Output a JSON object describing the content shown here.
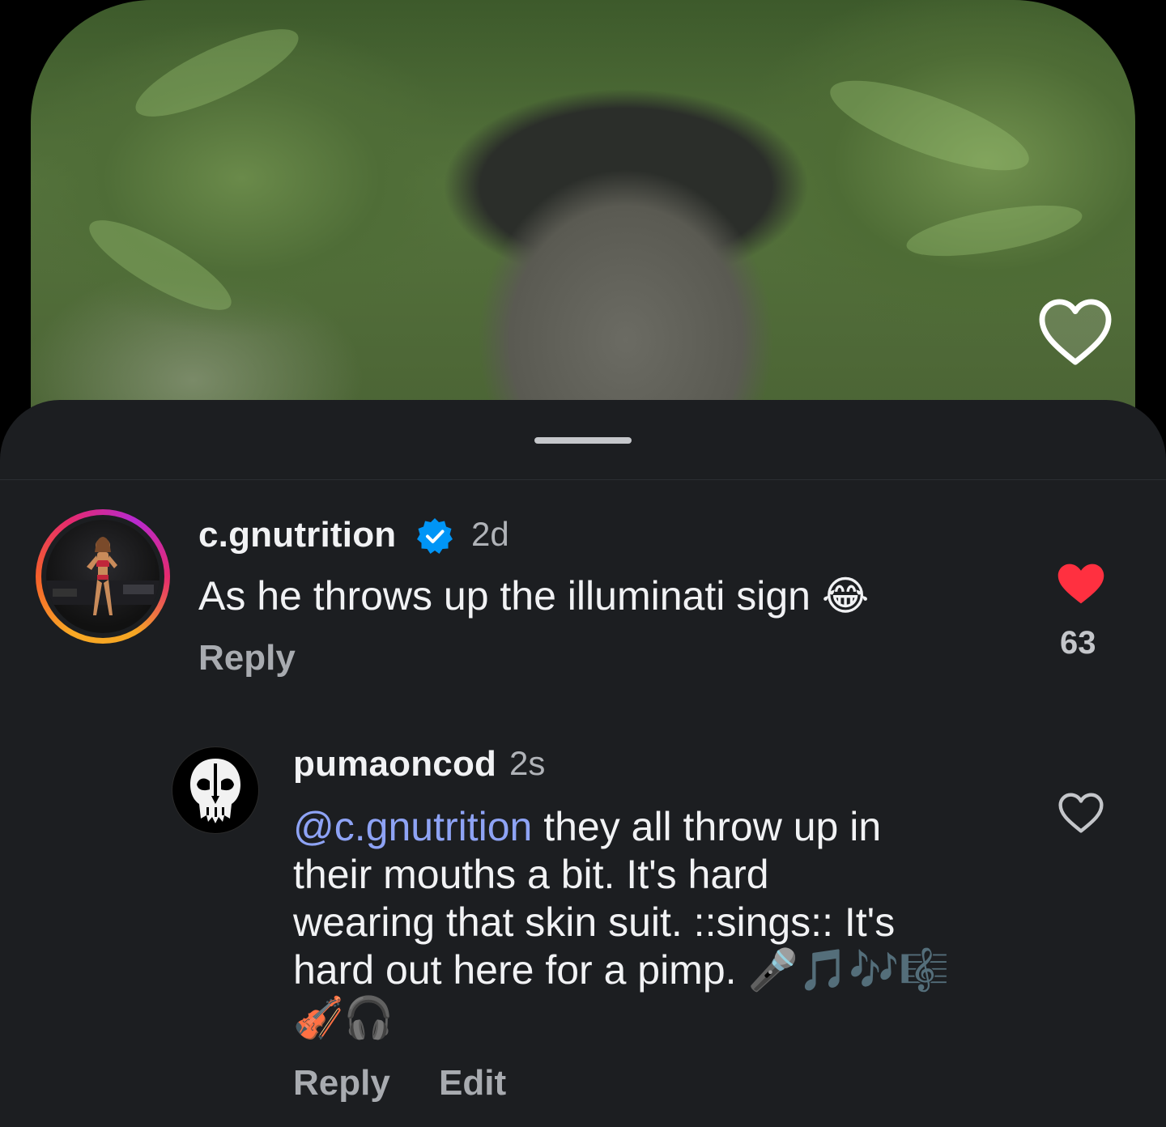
{
  "comments": [
    {
      "username": "c.gnutrition",
      "verified": true,
      "time": "2d",
      "text": "As he throws up the illuminati sign",
      "emoji": "😂",
      "reply_label": "Reply",
      "like_count": "63",
      "liked": true,
      "avatar": "fitness-competitor-photo"
    },
    {
      "username": "pumaoncod",
      "time": "2s",
      "mention": "@c.gnutrition",
      "text_lines": [
        " they all throw up in",
        "their mouths a bit. It's hard",
        "wearing that skin suit. ::sings:: It's",
        "hard out here for a pimp."
      ],
      "emoji_line1": "🎤🎵🎶🎼",
      "emoji_line2": "🎻🎧",
      "reply_label": "Reply",
      "edit_label": "Edit",
      "liked": false,
      "avatar": "skull-mask-logo"
    }
  ],
  "colors": {
    "sheet_bg": "#1c1e21",
    "like_red": "#ff3040",
    "mention_blue": "#8ea3f5",
    "verified_blue": "#0095f6"
  }
}
